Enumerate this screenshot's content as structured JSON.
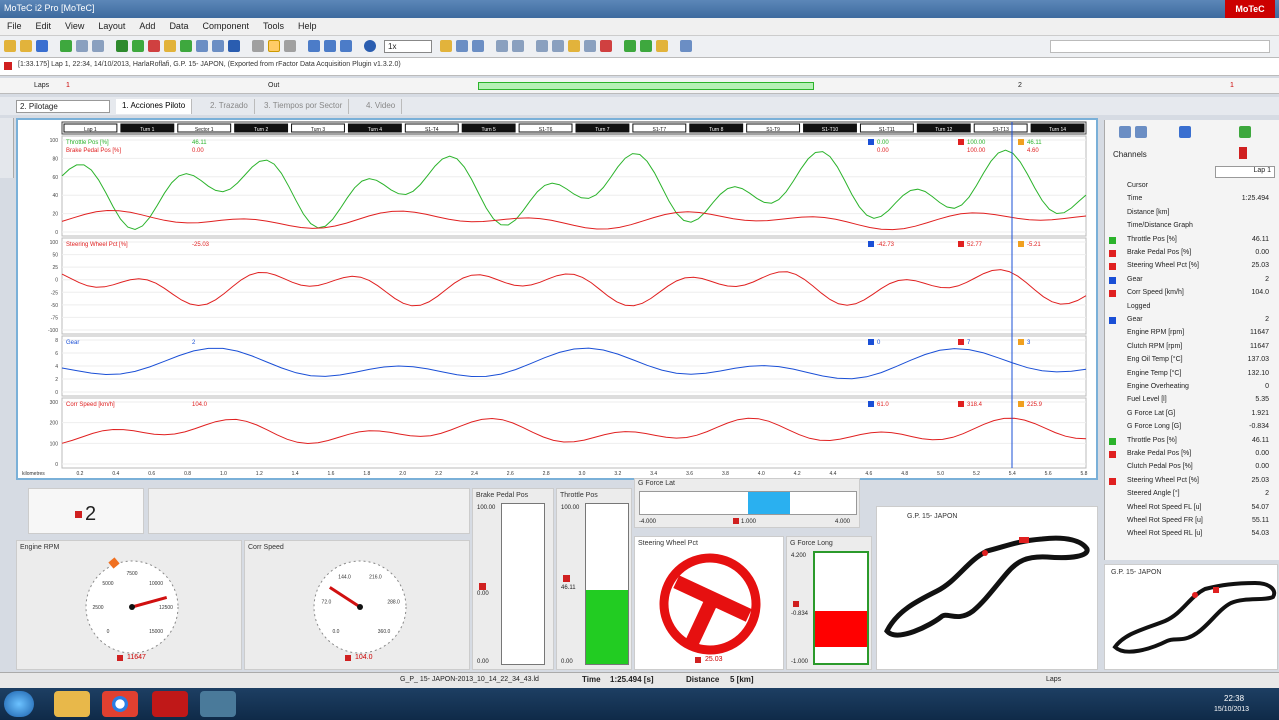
{
  "window": {
    "title": "MoTeC i2 Pro [MoTeC]",
    "logo": "MoTeC"
  },
  "menu": [
    "File",
    "Edit",
    "View",
    "Layout",
    "Add",
    "Data",
    "Component",
    "Tools",
    "Help"
  ],
  "toolbar": {
    "zoom_select": "1x"
  },
  "info": {
    "text": "[1:33.175] Lap 1, 22:34, 14/10/2013, HarlaRoflafi, G.P. 15- JAPON, (Exported from rFactor Data Acquisition Plugin v1.3.2.0)"
  },
  "laps": {
    "label": "Laps",
    "lap_marks": [
      "1",
      "Out",
      "2",
      "1"
    ]
  },
  "workbook": {
    "select": "2. Pilotage",
    "tabs": [
      "1. Acciones Piloto",
      "2. Trazado",
      "3. Tiempos por Sector",
      "4. Video"
    ]
  },
  "graph": {
    "sections": [
      "Lap 1",
      "Turn 1",
      "Sector 1",
      "Turn 2",
      "Turn 3",
      "Turn 4",
      "S1-T4",
      "Turn 5",
      "S1-T6",
      "Turn 7",
      "S1-T7",
      "Turn 8",
      "S1-T9",
      "S1-T10",
      "S1-T11",
      "Turn 12",
      "S1-T13",
      "Turn 14"
    ],
    "x_label": "kilometres",
    "x_ticks": [
      "0.2",
      "0.4",
      "0.6",
      "0.8",
      "1.0",
      "1.2",
      "1.4",
      "1.6",
      "1.8",
      "2.0",
      "2.2",
      "2.4",
      "2.6",
      "2.8",
      "3.0",
      "3.2",
      "3.4",
      "3.6",
      "3.8",
      "4.0",
      "4.2",
      "4.4",
      "4.6",
      "4.8",
      "5.0",
      "5.2",
      "5.4",
      "5.6",
      "5.8"
    ],
    "panes": [
      {
        "labels": [
          "Throttle Pos [%]",
          "Brake Pedal Pos [%]"
        ],
        "vals": [
          "46.11",
          "0.00"
        ],
        "cursor": [
          [
            "0.00",
            "0.00"
          ],
          [
            "100.00",
            "100.00"
          ],
          [
            "46.11",
            "4.60"
          ]
        ],
        "yt": [
          "100",
          "80",
          "60",
          "40",
          "20",
          "0"
        ]
      },
      {
        "labels": [
          "Steering Wheel Pct [%]"
        ],
        "vals": [
          "-25.03"
        ],
        "cursor": [
          [
            "-42.73"
          ],
          [
            "52.77"
          ],
          [
            "-5.21"
          ]
        ],
        "yt": [
          "100",
          "50",
          "25",
          "0",
          "-25",
          "-50",
          "-75",
          "-100"
        ]
      },
      {
        "labels": [
          "Gear"
        ],
        "vals": [
          "2"
        ],
        "cursor": [
          [
            "0"
          ],
          [
            "7"
          ],
          [
            "3"
          ]
        ],
        "yt": [
          "8",
          "6",
          "4",
          "2",
          "0"
        ]
      },
      {
        "labels": [
          "Corr Speed [km/h]"
        ],
        "vals": [
          "104.0"
        ],
        "cursor": [
          [
            "61.0"
          ],
          [
            "318.4"
          ],
          [
            "225.9"
          ]
        ],
        "yt": [
          "300",
          "200",
          "100",
          "0"
        ]
      }
    ]
  },
  "channels": {
    "header": "Channels",
    "lap": "Lap 1",
    "items": [
      {
        "n": "Cursor",
        "v": "",
        "c": ""
      },
      {
        "n": "Time",
        "v": "1:25.494",
        "c": ""
      },
      {
        "n": "Distance [km]",
        "v": "",
        "c": ""
      },
      {
        "n": "Time/Distance Graph",
        "v": "",
        "c": ""
      },
      {
        "n": "Throttle Pos [%]",
        "v": "46.11",
        "c": "#2bb32b"
      },
      {
        "n": "Brake Pedal Pos [%]",
        "v": "0.00",
        "c": "#e02020"
      },
      {
        "n": "Steering Wheel Pct [%]",
        "v": "25.03",
        "c": "#e02020"
      },
      {
        "n": "Gear",
        "v": "2",
        "c": "#1a4fd6"
      },
      {
        "n": "Corr Speed [km/h]",
        "v": "104.0",
        "c": "#e02020"
      },
      {
        "n": "Logged",
        "v": "",
        "c": ""
      },
      {
        "n": "Gear",
        "v": "2",
        "c": "#1a4fd6"
      },
      {
        "n": "Engine RPM [rpm]",
        "v": "11647",
        "c": ""
      },
      {
        "n": "Clutch RPM [rpm]",
        "v": "11647",
        "c": ""
      },
      {
        "n": "Eng Oil Temp [°C]",
        "v": "137.03",
        "c": ""
      },
      {
        "n": "Engine Temp [°C]",
        "v": "132.10",
        "c": ""
      },
      {
        "n": "Engine Overheating",
        "v": "0",
        "c": ""
      },
      {
        "n": "Fuel Level [l]",
        "v": "5.35",
        "c": ""
      },
      {
        "n": "G Force Lat [G]",
        "v": "1.921",
        "c": ""
      },
      {
        "n": "G Force Long [G]",
        "v": "-0.834",
        "c": ""
      },
      {
        "n": "Throttle Pos [%]",
        "v": "46.11",
        "c": "#2bb32b"
      },
      {
        "n": "Brake Pedal Pos [%]",
        "v": "0.00",
        "c": "#e02020"
      },
      {
        "n": "Clutch Pedal Pos [%]",
        "v": "0.00",
        "c": ""
      },
      {
        "n": "Steering Wheel Pct [%]",
        "v": "25.03",
        "c": "#e02020"
      },
      {
        "n": "Steered Angle [°]",
        "v": "2",
        "c": ""
      },
      {
        "n": "Wheel Rot Speed FL [u]",
        "v": "54.07",
        "c": ""
      },
      {
        "n": "Wheel Rot Speed FR [u]",
        "v": "55.11",
        "c": ""
      },
      {
        "n": "Wheel Rot Speed RL [u]",
        "v": "54.03",
        "c": ""
      }
    ]
  },
  "gauges": {
    "gear": "2",
    "rpm": {
      "title": "Engine RPM",
      "ticks": [
        "0",
        "2500",
        "5000",
        "7500",
        "10000",
        "12500",
        "15000"
      ],
      "value": "11647"
    },
    "speed": {
      "title": "Corr Speed",
      "ticks": [
        "0.0",
        "72.0",
        "144.0",
        "216.0",
        "288.0",
        "360.0"
      ],
      "value": "104.0"
    },
    "brake": {
      "title": "Brake Pedal Pos",
      "top": "100.00",
      "mid": "0.00",
      "bot": "0.00",
      "level": 0
    },
    "throttle": {
      "title": "Throttle Pos",
      "top": "100.00",
      "mid": "46.11",
      "bot": "0.00",
      "level": 46.11
    },
    "glat": {
      "title": "G Force Lat",
      "l": "-4.000",
      "c": "1.000",
      "r": "4.000"
    },
    "wheel": {
      "title": "Steering Wheel Pct",
      "value": "25.03"
    },
    "glong": {
      "title": "G Force Long",
      "top": "4.200",
      "mid": "-0.834",
      "bot": "-1.000"
    },
    "map1": "G.P. 15- JAPON",
    "map2": "G.P. 15- JAPON"
  },
  "status": {
    "file": "G_P_ 15- JAPON-2013_10_14_22_34_43.ld",
    "time_label": "Time",
    "time": "1:25.494 [s]",
    "dist_label": "Distance",
    "dist": "5 [km]",
    "laps": "Laps"
  },
  "clock": {
    "time": "22:38",
    "date": "15/10/2013"
  },
  "colors": {
    "throttle": "#2bb32b",
    "brake": "#e02020",
    "gear": "#1a4fd6",
    "steer": "#e02020",
    "accent": "#7ab0d8"
  }
}
